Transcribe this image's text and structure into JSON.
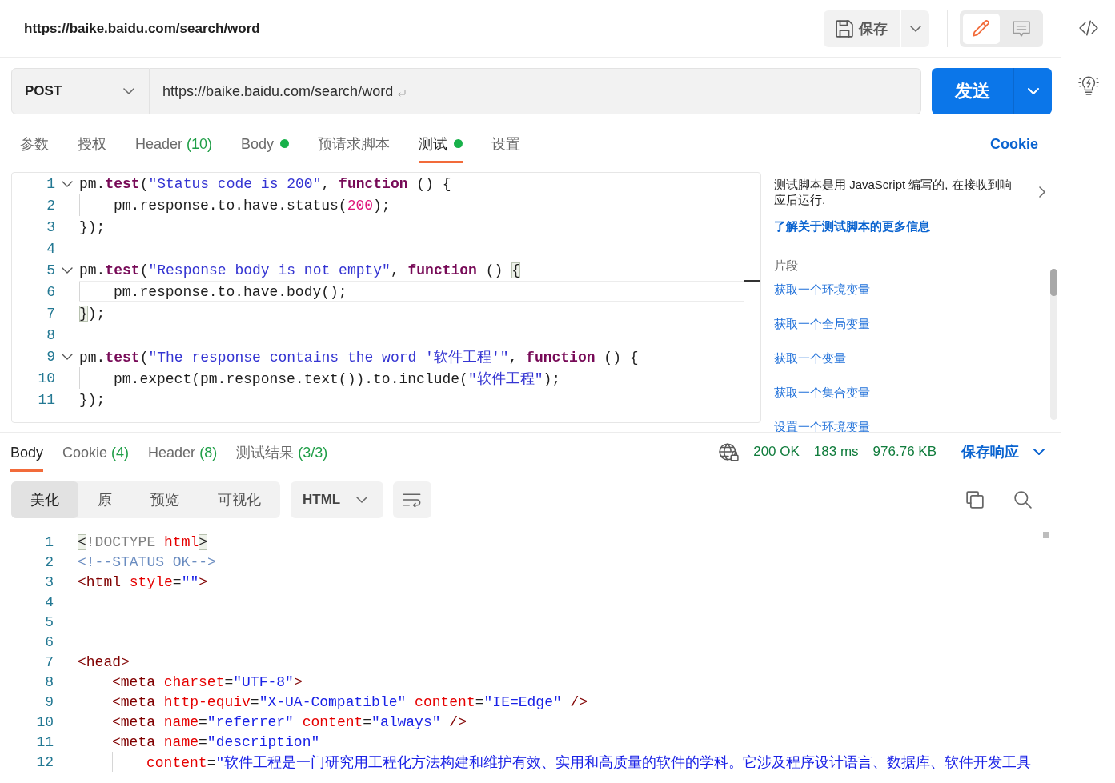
{
  "request_header": {
    "title": "https://baike.baidu.com/search/word",
    "save_label": "保存"
  },
  "view_toggle": [
    {
      "kind": "edit",
      "selected": true
    },
    {
      "kind": "comments",
      "selected": false
    }
  ],
  "request": {
    "method": "POST",
    "url": "https://baike.baidu.com/search/word",
    "send_label": "发送"
  },
  "request_tabs": [
    {
      "label": "参数",
      "selected": false,
      "dot": false
    },
    {
      "label": "授权",
      "selected": false,
      "dot": false
    },
    {
      "label": "Header",
      "count": "(10)",
      "selected": false,
      "dot": false
    },
    {
      "label": "Body",
      "selected": false,
      "dot": true
    },
    {
      "label": "预请求脚本",
      "selected": false,
      "dot": false
    },
    {
      "label": "测试",
      "selected": true,
      "dot": true
    },
    {
      "label": "设置",
      "selected": false,
      "dot": false
    }
  ],
  "cookie_link": "Cookie",
  "test_editor": {
    "lines": [
      {
        "number": "1",
        "foldable": true,
        "current": false,
        "tokens": [
          {
            "kind": "plain",
            "text": "pm."
          },
          {
            "kind": "keyword",
            "text": "test"
          },
          {
            "kind": "plain",
            "text": "("
          },
          {
            "kind": "string",
            "text": "\"Status code is 200\""
          },
          {
            "kind": "plain",
            "text": ", "
          },
          {
            "kind": "keyword",
            "text": "function"
          },
          {
            "kind": "plain",
            "text": " () {"
          }
        ],
        "children": [
          {
            "number": "2",
            "foldable": false,
            "current": false,
            "tokens": [
              {
                "kind": "plain",
                "text": "pm.response.to.have.status("
              },
              {
                "kind": "number",
                "text": "200"
              },
              {
                "kind": "plain",
                "text": ");"
              }
            ]
          }
        ]
      },
      {
        "number": "3",
        "foldable": false,
        "current": false,
        "tokens": [
          {
            "kind": "plain",
            "text": "});"
          }
        ]
      },
      {
        "number": "4",
        "foldable": false,
        "current": false
      },
      {
        "number": "5",
        "foldable": true,
        "current": false,
        "tokens": [
          {
            "kind": "plain",
            "text": "pm."
          },
          {
            "kind": "keyword",
            "text": "test"
          },
          {
            "kind": "plain",
            "text": "("
          },
          {
            "kind": "string",
            "text": "\"Response body is not empty\""
          },
          {
            "kind": "plain",
            "text": ", "
          },
          {
            "kind": "keyword",
            "text": "function"
          },
          {
            "kind": "plain",
            "text": " () "
          },
          {
            "kind": "match",
            "text": "{"
          }
        ],
        "children": [
          {
            "number": "6",
            "foldable": false,
            "current": true,
            "tokens": [
              {
                "kind": "plain",
                "text": "pm.response.to.have.body();"
              }
            ]
          }
        ]
      },
      {
        "number": "7",
        "foldable": false,
        "current": false,
        "tokens": [
          {
            "kind": "match",
            "text": "}"
          },
          {
            "kind": "plain",
            "text": ");"
          }
        ]
      },
      {
        "number": "8",
        "foldable": false,
        "current": false
      },
      {
        "number": "9",
        "foldable": true,
        "current": false,
        "tokens": [
          {
            "kind": "plain",
            "text": "pm."
          },
          {
            "kind": "keyword",
            "text": "test"
          },
          {
            "kind": "plain",
            "text": "("
          },
          {
            "kind": "string",
            "text": "\"The response contains the word '软件工程'\""
          },
          {
            "kind": "plain",
            "text": ", "
          },
          {
            "kind": "keyword",
            "text": "function"
          },
          {
            "kind": "plain",
            "text": " () {"
          }
        ],
        "children": [
          {
            "number": "10",
            "foldable": false,
            "current": false,
            "tokens": [
              {
                "kind": "plain",
                "text": "pm.expect(pm.response.text()).to.include("
              },
              {
                "kind": "string",
                "text": "\"软件工程\""
              },
              {
                "kind": "plain",
                "text": ");"
              }
            ]
          }
        ]
      },
      {
        "number": "11",
        "foldable": false,
        "current": false,
        "tokens": [
          {
            "kind": "plain",
            "text": "});"
          }
        ]
      }
    ]
  },
  "help_panel": {
    "description": "测试脚本是用 JavaScript 编写的, 在接收到响应后运行.",
    "link": "了解关于测试脚本的更多信息",
    "snippets_heading": "片段",
    "snippets": [
      "获取一个环境变量",
      "获取一个全局变量",
      "获取一个变量",
      "获取一个集合变量",
      "设置一个环境变量"
    ]
  },
  "response": {
    "tabs": [
      {
        "label": "Body",
        "selected": true
      },
      {
        "label": "Cookie",
        "count": "(4)",
        "selected": false
      },
      {
        "label": "Header",
        "count": "(8)",
        "selected": false
      },
      {
        "label": "测试结果",
        "count": "(3/3)",
        "selected": false
      }
    ],
    "status": "200 OK",
    "time": "183 ms",
    "size": "976.76 KB",
    "save_label": "保存响应",
    "view_modes": [
      {
        "label": "美化",
        "selected": true
      },
      {
        "label": "原",
        "selected": false
      },
      {
        "label": "预览",
        "selected": false
      },
      {
        "label": "可视化",
        "selected": false
      }
    ],
    "format": "HTML",
    "lines": [
      {
        "number": "1",
        "tokens": [
          {
            "kind": "match",
            "text": "<"
          },
          {
            "kind": "doctype",
            "text": "!DOCTYPE "
          },
          {
            "kind": "attr",
            "text": "html"
          },
          {
            "kind": "match",
            "text": ">"
          }
        ]
      },
      {
        "number": "2",
        "tokens": [
          {
            "kind": "comment",
            "text": "<!--STATUS OK-->"
          }
        ]
      },
      {
        "number": "3",
        "tokens": [
          {
            "kind": "tag",
            "text": "<html"
          },
          {
            "kind": "attr",
            "text": " style"
          },
          {
            "kind": "plain",
            "text": "="
          },
          {
            "kind": "value",
            "text": "\"\""
          },
          {
            "kind": "tag",
            "text": ">"
          }
        ]
      },
      {
        "number": "4"
      },
      {
        "number": "5"
      },
      {
        "number": "6"
      },
      {
        "number": "7",
        "tokens": [
          {
            "kind": "tag",
            "text": "<head>"
          }
        ],
        "children": [
          {
            "number": "8",
            "tokens": [
              {
                "kind": "tag",
                "text": "<meta"
              },
              {
                "kind": "attr",
                "text": " charset"
              },
              {
                "kind": "plain",
                "text": "="
              },
              {
                "kind": "value",
                "text": "\"UTF-8\""
              },
              {
                "kind": "tag",
                "text": ">"
              }
            ]
          },
          {
            "number": "9",
            "tokens": [
              {
                "kind": "tag",
                "text": "<meta"
              },
              {
                "kind": "attr",
                "text": " http-equiv"
              },
              {
                "kind": "plain",
                "text": "="
              },
              {
                "kind": "value",
                "text": "\"X-UA-Compatible\""
              },
              {
                "kind": "attr",
                "text": " content"
              },
              {
                "kind": "plain",
                "text": "="
              },
              {
                "kind": "value",
                "text": "\"IE=Edge\""
              },
              {
                "kind": "tag",
                "text": " />"
              }
            ]
          },
          {
            "number": "10",
            "tokens": [
              {
                "kind": "tag",
                "text": "<meta"
              },
              {
                "kind": "attr",
                "text": " name"
              },
              {
                "kind": "plain",
                "text": "="
              },
              {
                "kind": "value",
                "text": "\"referrer\""
              },
              {
                "kind": "attr",
                "text": " content"
              },
              {
                "kind": "plain",
                "text": "="
              },
              {
                "kind": "value",
                "text": "\"always\""
              },
              {
                "kind": "tag",
                "text": " />"
              }
            ]
          },
          {
            "number": "11",
            "tokens": [
              {
                "kind": "tag",
                "text": "<meta"
              },
              {
                "kind": "attr",
                "text": " name"
              },
              {
                "kind": "plain",
                "text": "="
              },
              {
                "kind": "value",
                "text": "\"description\""
              }
            ],
            "children": [
              {
                "number": "12",
                "tokens": [
                  {
                    "kind": "attr",
                    "text": "content"
                  },
                  {
                    "kind": "plain",
                    "text": "="
                  },
                  {
                    "kind": "value",
                    "text": "\"软件工程是一门研究用工程化方法构建和维护有效、实用和高质量的软件的学科。它涉及程序设计语言、数据库、软件开发工具"
                  }
                ]
              }
            ]
          }
        ]
      }
    ]
  }
}
